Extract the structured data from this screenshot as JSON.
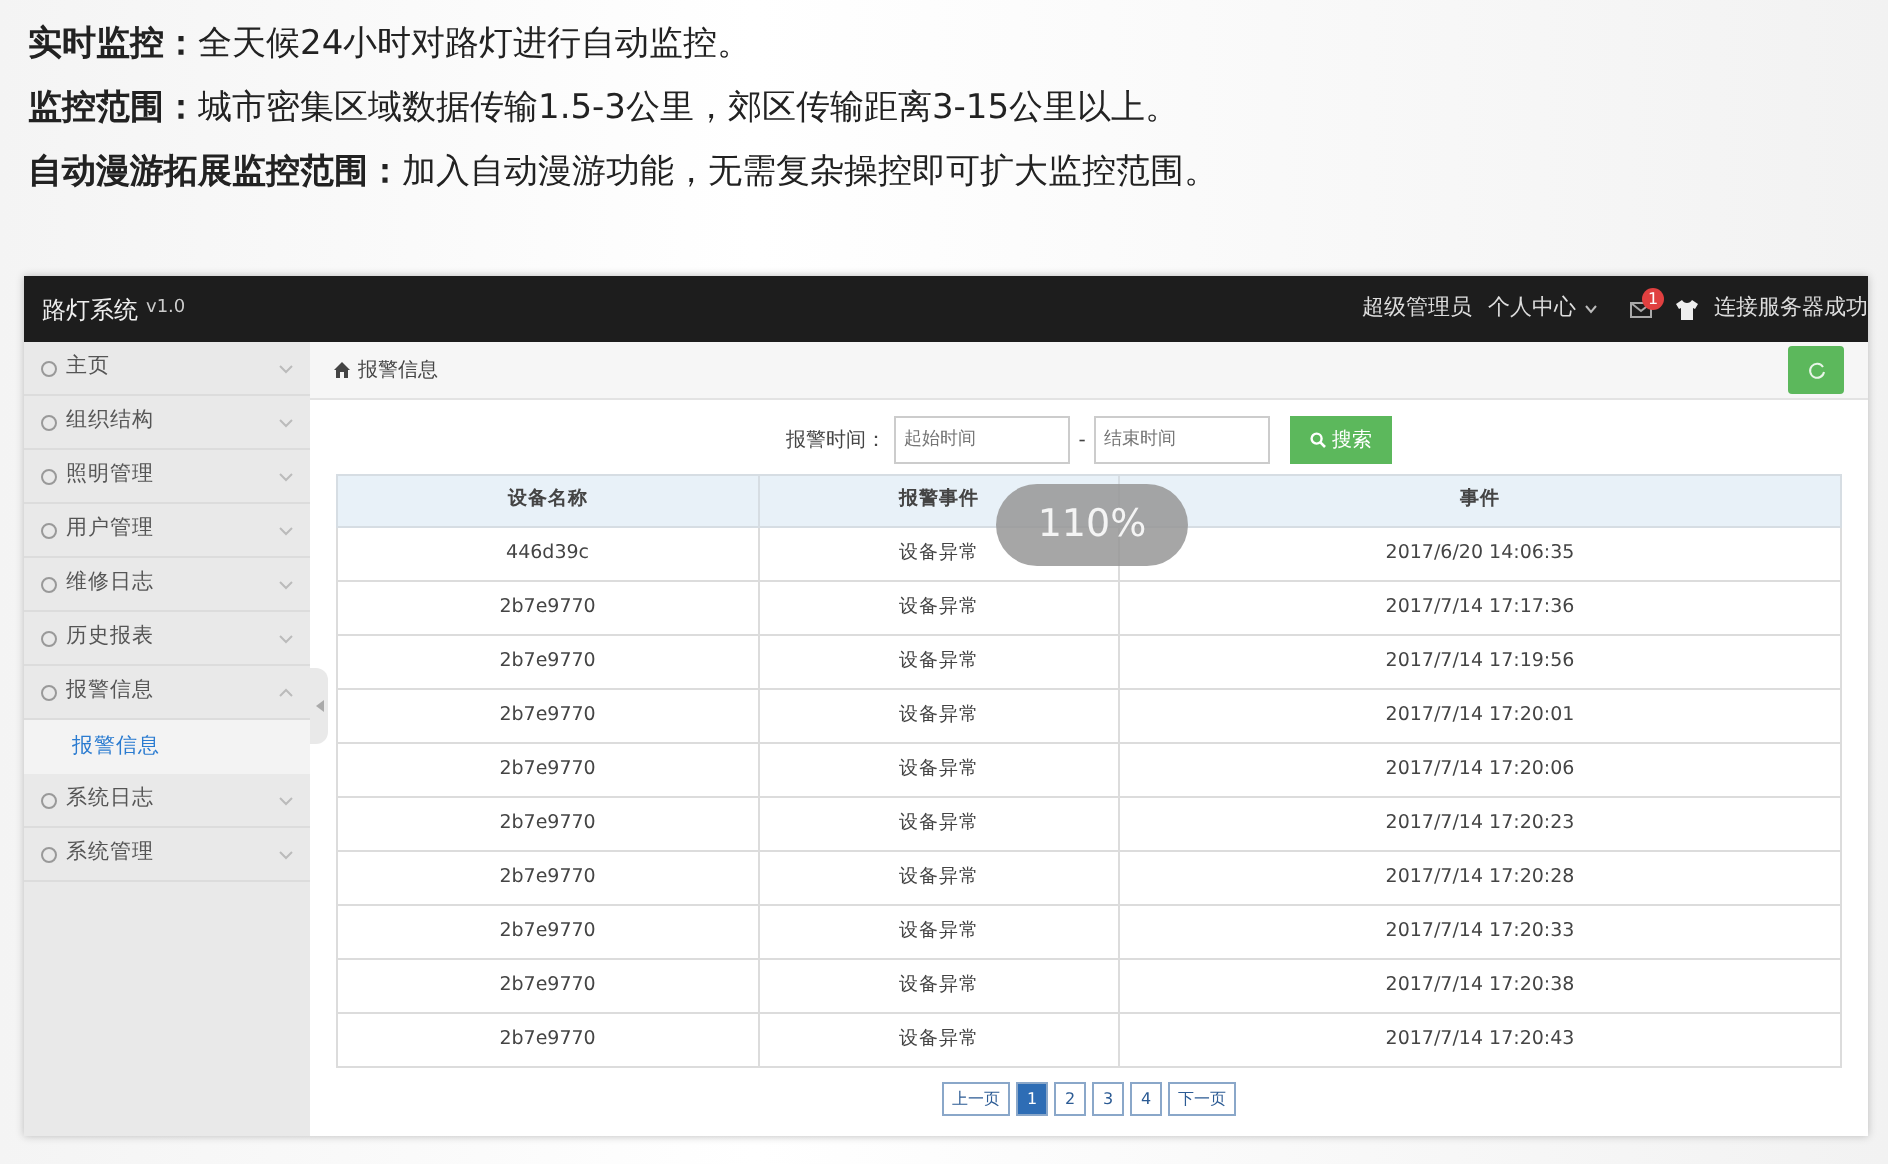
{
  "intro": [
    "**实时监控：**全天候24小时对路灯进行自动监控。",
    "**监控范围：**城市密集区域数据传输1.5-3公里，郊区传输距离3-15公里以上。",
    "**自动漫游拓展监控范围：**加入自动漫游功能，无需复杂操控即可扩大监控范围。"
  ],
  "app": {
    "brand": "路灯系统",
    "version": "v1.0",
    "user": "超级管理员",
    "menu": "个人中心",
    "badge": "1",
    "status": "连接服务器成功",
    "sidebar": [
      {
        "label": "主页",
        "expanded": false
      },
      {
        "label": "组织结构",
        "expanded": false
      },
      {
        "label": "照明管理",
        "expanded": false
      },
      {
        "label": "用户管理",
        "expanded": false
      },
      {
        "label": "维修日志",
        "expanded": false
      },
      {
        "label": "历史报表",
        "expanded": false
      },
      {
        "label": "报警信息",
        "expanded": true,
        "children": [
          {
            "label": "报警信息",
            "selected": true
          }
        ]
      },
      {
        "label": "系统日志",
        "expanded": false
      },
      {
        "label": "系统管理",
        "expanded": false
      }
    ],
    "breadcrumb": "报警信息",
    "filter": {
      "label": "报警时间：",
      "start_placeholder": "起始时间",
      "separator": "-",
      "end_placeholder": "结束时间",
      "button": "搜索"
    },
    "table": {
      "columns": [
        "设备名称",
        "报警事件",
        "事件"
      ],
      "rows": [
        [
          "446d39c",
          "设备异常",
          "2017/6/20 14:06:35"
        ],
        [
          "2b7e9770",
          "设备异常",
          "2017/7/14 17:17:36"
        ],
        [
          "2b7e9770",
          "设备异常",
          "2017/7/14 17:19:56"
        ],
        [
          "2b7e9770",
          "设备异常",
          "2017/7/14 17:20:01"
        ],
        [
          "2b7e9770",
          "设备异常",
          "2017/7/14 17:20:06"
        ],
        [
          "2b7e9770",
          "设备异常",
          "2017/7/14 17:20:23"
        ],
        [
          "2b7e9770",
          "设备异常",
          "2017/7/14 17:20:28"
        ],
        [
          "2b7e9770",
          "设备异常",
          "2017/7/14 17:20:33"
        ],
        [
          "2b7e9770",
          "设备异常",
          "2017/7/14 17:20:38"
        ],
        [
          "2b7e9770",
          "设备异常",
          "2017/7/14 17:20:43"
        ]
      ]
    },
    "pagination": [
      {
        "label": "上一页",
        "selected": false
      },
      {
        "label": "1",
        "selected": true
      },
      {
        "label": "2",
        "selected": false
      },
      {
        "label": "3",
        "selected": false
      },
      {
        "label": "4",
        "selected": false
      },
      {
        "label": "下一页",
        "selected": false
      }
    ]
  },
  "zoom_indicator": "110%"
}
